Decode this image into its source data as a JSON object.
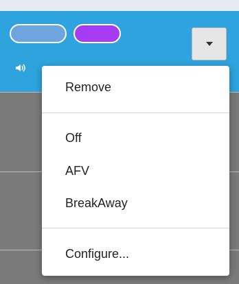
{
  "menu": {
    "items": [
      {
        "label": "Remove"
      },
      {
        "label": "Off"
      },
      {
        "label": "AFV"
      },
      {
        "label": "BreakAway"
      },
      {
        "label": "Configure..."
      }
    ]
  },
  "colors": {
    "header": "#2ea3dd",
    "pill_blue": "#6ea5df",
    "pill_purple": "#a63df5",
    "background": "#7a7a7a"
  },
  "icons": [
    "speaker-icon",
    "caret-down-icon"
  ]
}
